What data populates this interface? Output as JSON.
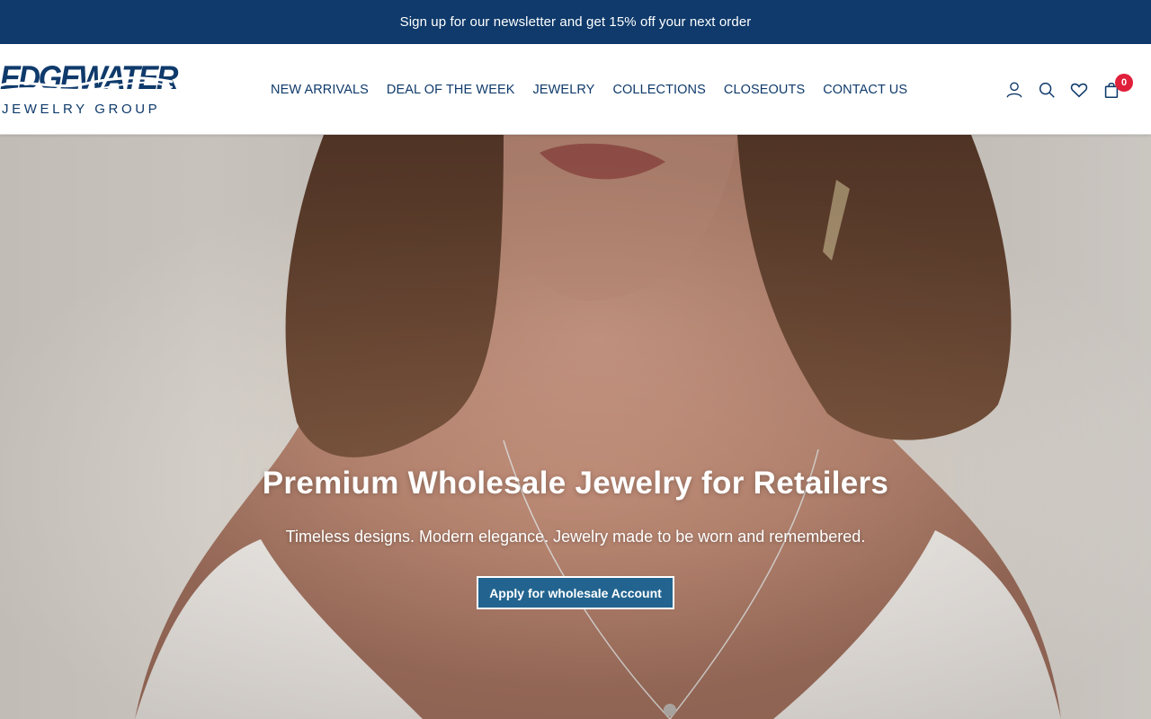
{
  "announcement": {
    "text": "Sign up for our newsletter and get 15% off your next order"
  },
  "logo": {
    "wordmark": "EDGEWATER",
    "tagline": "JEWELRY GROUP"
  },
  "nav": {
    "items": [
      {
        "label": "NEW ARRIVALS"
      },
      {
        "label": "DEAL OF THE WEEK"
      },
      {
        "label": "JEWELRY"
      },
      {
        "label": "COLLECTIONS"
      },
      {
        "label": "CLOSEOUTS"
      },
      {
        "label": "CONTACT US"
      }
    ]
  },
  "header_icons": {
    "account": "user-icon",
    "search": "search-icon",
    "wishlist": "heart-icon",
    "cart": "shopping-bag-icon",
    "cart_count": "0"
  },
  "hero": {
    "title": "Premium Wholesale Jewelry for Retailers",
    "subtitle": "Timeless designs. Modern elegance. Jewelry made to be worn and remembered.",
    "cta_label": "Apply for wholesale Account"
  },
  "colors": {
    "brand_navy": "#0f3a6b",
    "cta_blue": "#22648f",
    "badge_red": "#e0203a"
  }
}
